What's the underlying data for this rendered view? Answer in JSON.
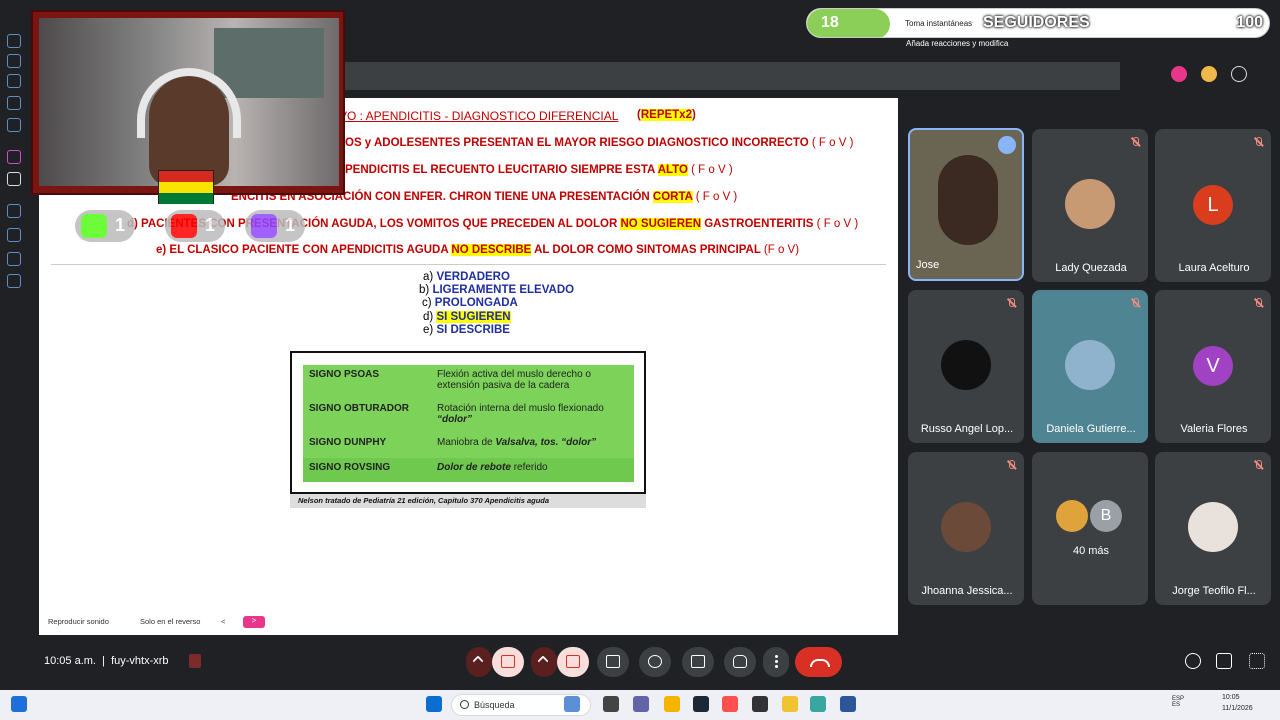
{
  "followers": {
    "count": "18",
    "label": "SEGUIDORES",
    "goal": "100",
    "fill_fraction": 0.18
  },
  "notifications": {
    "line1": "Toma instantáneas",
    "line2": "Añada reacciones y modifica"
  },
  "slide": {
    "title": "VO : APENDICITIS - DIAGNOSTICO DIFERENCIAL",
    "title_tag": "REPETx2",
    "q1": {
      "text": "OS y ADOLESENTES PRESENTAN EL MAYOR RIESGO DIAGNOSTICO INCORRECTO",
      "tail": "( F o V )"
    },
    "q2": {
      "pre": "PENDICITIS EL RECUENTO LEUCITARIO SIEMPRE ESTA",
      "hl": "ALTO",
      "tail": "( F o V )"
    },
    "q3": {
      "pre": "ENCITIS EN ASOCIACIÓN CON ENFER. CHRON TIENE UNA PRESENTACIÓN",
      "hl": "CORTA",
      "tail": "( F o V )"
    },
    "q4": {
      "pre": "d) PACIENTES CON PRESENTACIÓN AGUDA, LOS VOMITOS QUE PRECEDEN AL DOLOR",
      "hl": "NO SUGIEREN",
      "post": "GASTROENTERITIS",
      "tail": "( F o V )"
    },
    "q5": {
      "pre": "e) EL CLASICO PACIENTE CON APENDICITIS AGUDA",
      "hl": "NO DESCRIBE",
      "post": "AL DOLOR COMO SINTOMAS PRINCIPAL",
      "tail": "(F o V)"
    },
    "answers": [
      {
        "letter": "a)",
        "text": "VERDADERO"
      },
      {
        "letter": "b)",
        "text": "LIGERAMENTE  ELEVADO"
      },
      {
        "letter": "c)",
        "text": "PROLONGADA"
      },
      {
        "letter": "d)",
        "text": "SI SUGIEREN"
      },
      {
        "letter": "e)",
        "text": "SI DESCRIBE"
      }
    ],
    "signs": [
      {
        "name": "SIGNO PSOAS",
        "desc": "Flexión activa del muslo derecho o extensión pasiva de la cadera"
      },
      {
        "name": "SIGNO OBTURADOR",
        "desc": "Rotación interna del muslo flexionado",
        "desc_em": "“dolor”"
      },
      {
        "name": "SIGNO DUNPHY",
        "desc": "Maniobra de",
        "desc_em": "Valsalva, tos. “dolor”"
      },
      {
        "name": "SIGNO ROVSING",
        "desc_em": "Dolor de rebote",
        "desc": "referido"
      }
    ],
    "caption": "Nelson tratado de Pediatría 21 edición, Capitulo 370 Apendicitis aguda",
    "controls": {
      "sound": "Reproducir sonido",
      "reverse": "Solo en el reverso",
      "prev": "<",
      "next": ">"
    }
  },
  "social": [
    {
      "name": "kick-icon",
      "count": "1",
      "color": "#53fc18"
    },
    {
      "name": "youtube-icon",
      "count": "1",
      "color": "#ff0000"
    },
    {
      "name": "twitch-icon",
      "count": "1",
      "color": "#9146ff"
    }
  ],
  "participants": [
    {
      "name": "Jose",
      "muted": false,
      "kind": "video"
    },
    {
      "name": "Lady Quezada",
      "muted": true,
      "kind": "photo",
      "color": "#c79a74"
    },
    {
      "name": "Laura Acelturo",
      "muted": true,
      "kind": "letter",
      "letter": "L",
      "color": "#d93d1d"
    },
    {
      "name": "Russo Angel Lop...",
      "muted": true,
      "kind": "photo",
      "color": "#111111"
    },
    {
      "name": "Daniela Gutierre...",
      "muted": true,
      "kind": "photo",
      "color": "#8fb3cc"
    },
    {
      "name": "Valeria Flores",
      "muted": true,
      "kind": "letter",
      "letter": "V",
      "color": "#a142c4"
    },
    {
      "name": "Jhoanna Jessica...",
      "muted": true,
      "kind": "photo",
      "color": "#6b4a3a"
    },
    {
      "name": "40 más",
      "muted": false,
      "kind": "more",
      "letter": "B"
    },
    {
      "name": "Jorge Teofilo Fl...",
      "muted": true,
      "kind": "photo",
      "color": "#e9e2dc"
    }
  ],
  "meeting": {
    "time": "10:05 a.m.",
    "separator": "|",
    "code": "fuy-vhtx-xrb"
  },
  "taskbar": {
    "search": "Búsqueda",
    "clock_time": "10:05",
    "clock_date": "11/1/2026",
    "lang": "ESP ES"
  }
}
